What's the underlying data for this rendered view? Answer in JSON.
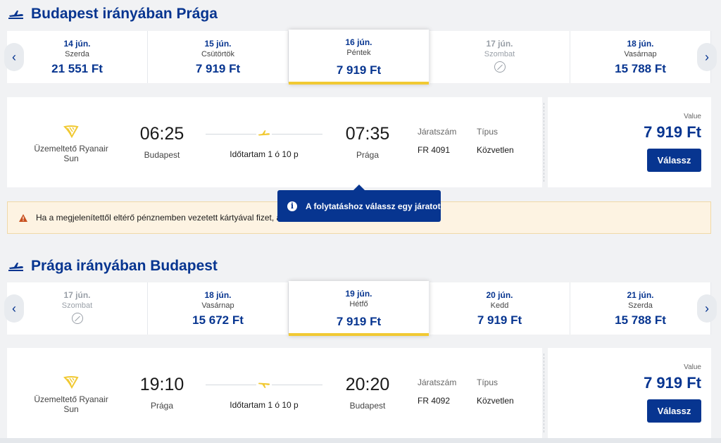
{
  "outbound": {
    "title": "Budapest irányában Prága",
    "dates": [
      {
        "date": "14 jún.",
        "weekday": "Szerda",
        "price": "21 551 Ft",
        "state": "available"
      },
      {
        "date": "15 jún.",
        "weekday": "Csütörtök",
        "price": "7 919 Ft",
        "state": "available"
      },
      {
        "date": "16 jún.",
        "weekday": "Péntek",
        "price": "7 919 Ft",
        "state": "selected"
      },
      {
        "date": "17 jún.",
        "weekday": "Szombat",
        "price": "",
        "state": "disabled"
      },
      {
        "date": "18 jún.",
        "weekday": "Vasárnap",
        "price": "15 788 Ft",
        "state": "available"
      }
    ],
    "flight": {
      "operator": "Üzemeltető Ryanair Sun",
      "depart_time": "06:25",
      "depart_city": "Budapest",
      "arrive_time": "07:35",
      "arrive_city": "Prága",
      "duration": "Időtartam 1 ó 10 p",
      "flight_no_label": "Járatszám",
      "flight_no": "FR 4091",
      "type_label": "Típus",
      "type": "Közvetlen",
      "fare_label": "Value",
      "price": "7 919 Ft",
      "select_label": "Válassz"
    }
  },
  "warning": {
    "text": "Ha a megjelenítettől eltérő pénznemben vezetett kártyával fizet, a"
  },
  "tooltip": {
    "text": "A folytatáshoz válassz egy járatot"
  },
  "inbound": {
    "title": "Prága irányában Budapest",
    "dates": [
      {
        "date": "17 jún.",
        "weekday": "Szombat",
        "price": "",
        "state": "disabled"
      },
      {
        "date": "18 jún.",
        "weekday": "Vasárnap",
        "price": "15 672 Ft",
        "state": "available"
      },
      {
        "date": "19 jún.",
        "weekday": "Hétfő",
        "price": "7 919 Ft",
        "state": "selected"
      },
      {
        "date": "20 jún.",
        "weekday": "Kedd",
        "price": "7 919 Ft",
        "state": "available"
      },
      {
        "date": "21 jún.",
        "weekday": "Szerda",
        "price": "15 788 Ft",
        "state": "available"
      }
    ],
    "flight": {
      "operator": "Üzemeltető Ryanair Sun",
      "depart_time": "19:10",
      "depart_city": "Prága",
      "arrive_time": "20:20",
      "arrive_city": "Budapest",
      "duration": "Időtartam 1 ó 10 p",
      "flight_no_label": "Járatszám",
      "flight_no": "FR 4092",
      "type_label": "Típus",
      "type": "Közvetlen",
      "fare_label": "Value",
      "price": "7 919 Ft",
      "select_label": "Válassz"
    }
  },
  "colors": {
    "brand_blue": "#073590",
    "accent_yellow": "#f1c933",
    "warning_bg": "#fdf3e2"
  }
}
